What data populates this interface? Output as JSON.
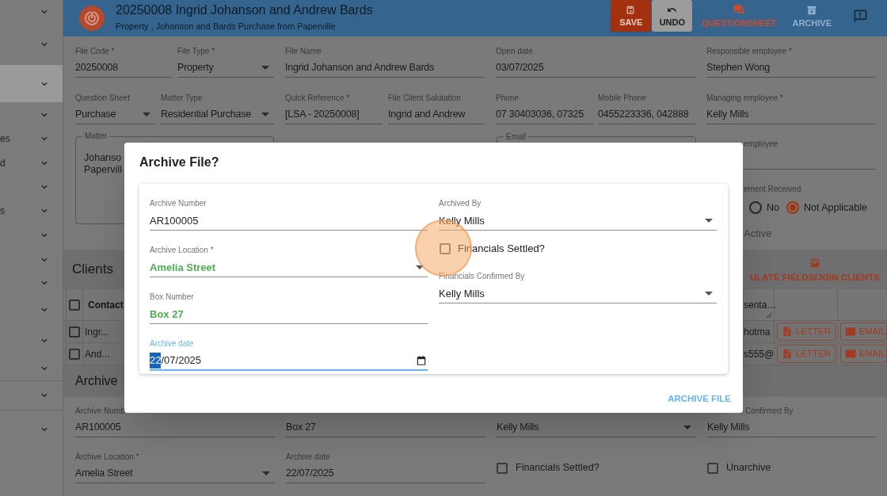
{
  "sidebar": {
    "items": [
      {
        "selected": false
      },
      {
        "selected": false
      },
      {
        "selected": true
      },
      {
        "selected": false
      },
      {
        "label": "es",
        "selected": false
      },
      {
        "label": "d",
        "selected": false
      },
      {
        "selected": false
      },
      {
        "label": "s",
        "selected": false
      },
      {
        "selected": false
      },
      {
        "selected": false
      },
      {
        "selected": false
      },
      {
        "selected": false
      },
      {
        "selected": false
      },
      {
        "selected": false
      },
      {
        "selected": false
      },
      {
        "selected": false
      }
    ]
  },
  "header": {
    "title": "20250008 Ingrid Johanson and Andrew Bards",
    "subtitle": "Property , Johanson and Bards Purchase from Paperville",
    "actions": [
      {
        "kind": "save",
        "label": "SAVE",
        "disabled": false
      },
      {
        "kind": "undo",
        "label": "UNDO",
        "disabled": false
      },
      {
        "kind": "questionsheet",
        "label": "QUESTIONSHEET",
        "disabled": false
      },
      {
        "kind": "archive",
        "label": "ARCHIVE",
        "disabled": true
      }
    ]
  },
  "file_form": {
    "row_1": [
      {
        "kind": "text",
        "label": "File Code *",
        "value": "20250008"
      },
      {
        "kind": "select",
        "label": "File Type *",
        "value": "Property"
      },
      {
        "kind": "text",
        "label": "File Name",
        "value": "Ingrid Johanson and Andrew Bards"
      },
      {
        "kind": "text",
        "label": "Open date",
        "value": "03/07/2025"
      },
      {
        "kind": "text",
        "label": "Responsible employee *",
        "value": "Stephen Wong"
      }
    ],
    "row_2": [
      {
        "kind": "select",
        "label": "Question Sheet",
        "value": "Purchase"
      },
      {
        "kind": "select",
        "label": "Matter Type",
        "value": "Residential Purchase"
      },
      {
        "kind": "text",
        "label": "Quick Reference *",
        "value": "[LSA - 20250008]"
      },
      {
        "kind": "text",
        "label": "File Client Salutation",
        "value": "Ingrid and Andrew"
      },
      {
        "kind": "text",
        "label": "Phone",
        "value": "07 30403036, 07325"
      },
      {
        "kind": "text",
        "label": "Mobile Phone",
        "value": "0455223336, 042888"
      },
      {
        "kind": "text",
        "label": "Managing employee *",
        "value": "Kelly Mills"
      }
    ],
    "matter": {
      "label": "Matter",
      "value": "Johanso\nPapervill"
    },
    "email": {
      "label": "Email"
    },
    "assistant_employee": {
      "label": "employee"
    },
    "settlement": {
      "label": "ement Received",
      "options": [
        {
          "label": "No",
          "selected": false
        },
        {
          "label": "Not Applicable",
          "selected": true
        }
      ]
    },
    "active": {
      "label": "Active",
      "disabled": true
    }
  },
  "clients": {
    "title": "Clients",
    "all_checked": false,
    "action": "ULATE FIELDS/JOIN CLIENTS",
    "columns": [
      "Contact",
      "senta…"
    ],
    "rows": [
      {
        "checked": false,
        "contact": "Ingr...",
        "email": "hotma",
        "letter_button": "LETTER",
        "email_button": "EMAIL"
      },
      {
        "checked": false,
        "contact": "And...",
        "email": "s555@",
        "letter_button": "LETTER",
        "email_button": "EMAIL"
      }
    ]
  },
  "archive_section": {
    "title": "Archive",
    "row_1": [
      {
        "kind": "text",
        "label": "Archive Numb",
        "value": "AR100005"
      },
      {
        "kind": "text",
        "value": "Box 27"
      },
      {
        "kind": "select",
        "value": "Kelly Mills"
      },
      {
        "kind": "text",
        "label": "Confirmed By",
        "value": "Kelly Mills"
      }
    ],
    "row_2": [
      {
        "kind": "select",
        "label": "Archive Location *",
        "value": "Amelia Street"
      },
      {
        "kind": "text",
        "label": "Archive date",
        "value": "22/07/2025"
      },
      {
        "kind": "checkbox",
        "label": "Financials Settled?",
        "checked": false
      },
      {
        "kind": "checkbox",
        "label": "Unarchive",
        "checked": false
      }
    ]
  },
  "dialog": {
    "title": "Archive File?",
    "left": [
      {
        "kind": "text",
        "label": "Archive Number",
        "value": "AR100005",
        "valid": false,
        "focused": false
      },
      {
        "kind": "select",
        "label": "Archive Location *",
        "value": "Amelia Street",
        "valid": true,
        "focused": false
      },
      {
        "kind": "text",
        "label": "Box Number",
        "value": "Box 27",
        "valid": true,
        "focused": false
      },
      {
        "kind": "date",
        "label": "Archive date",
        "value": "22/07/2025",
        "valid": false,
        "focused": true
      }
    ],
    "right": [
      {
        "kind": "select",
        "label": "Archived By",
        "value": "Kelly Mills",
        "valid": false,
        "focused": false
      },
      {
        "kind": "checkbox",
        "label": "Financials Settled?",
        "checked": false
      },
      {
        "kind": "select",
        "label": "Financials Confirmed By",
        "value": "Kelly Mills",
        "valid": false,
        "focused": false
      }
    ],
    "button": "ARCHIVE FILE"
  }
}
